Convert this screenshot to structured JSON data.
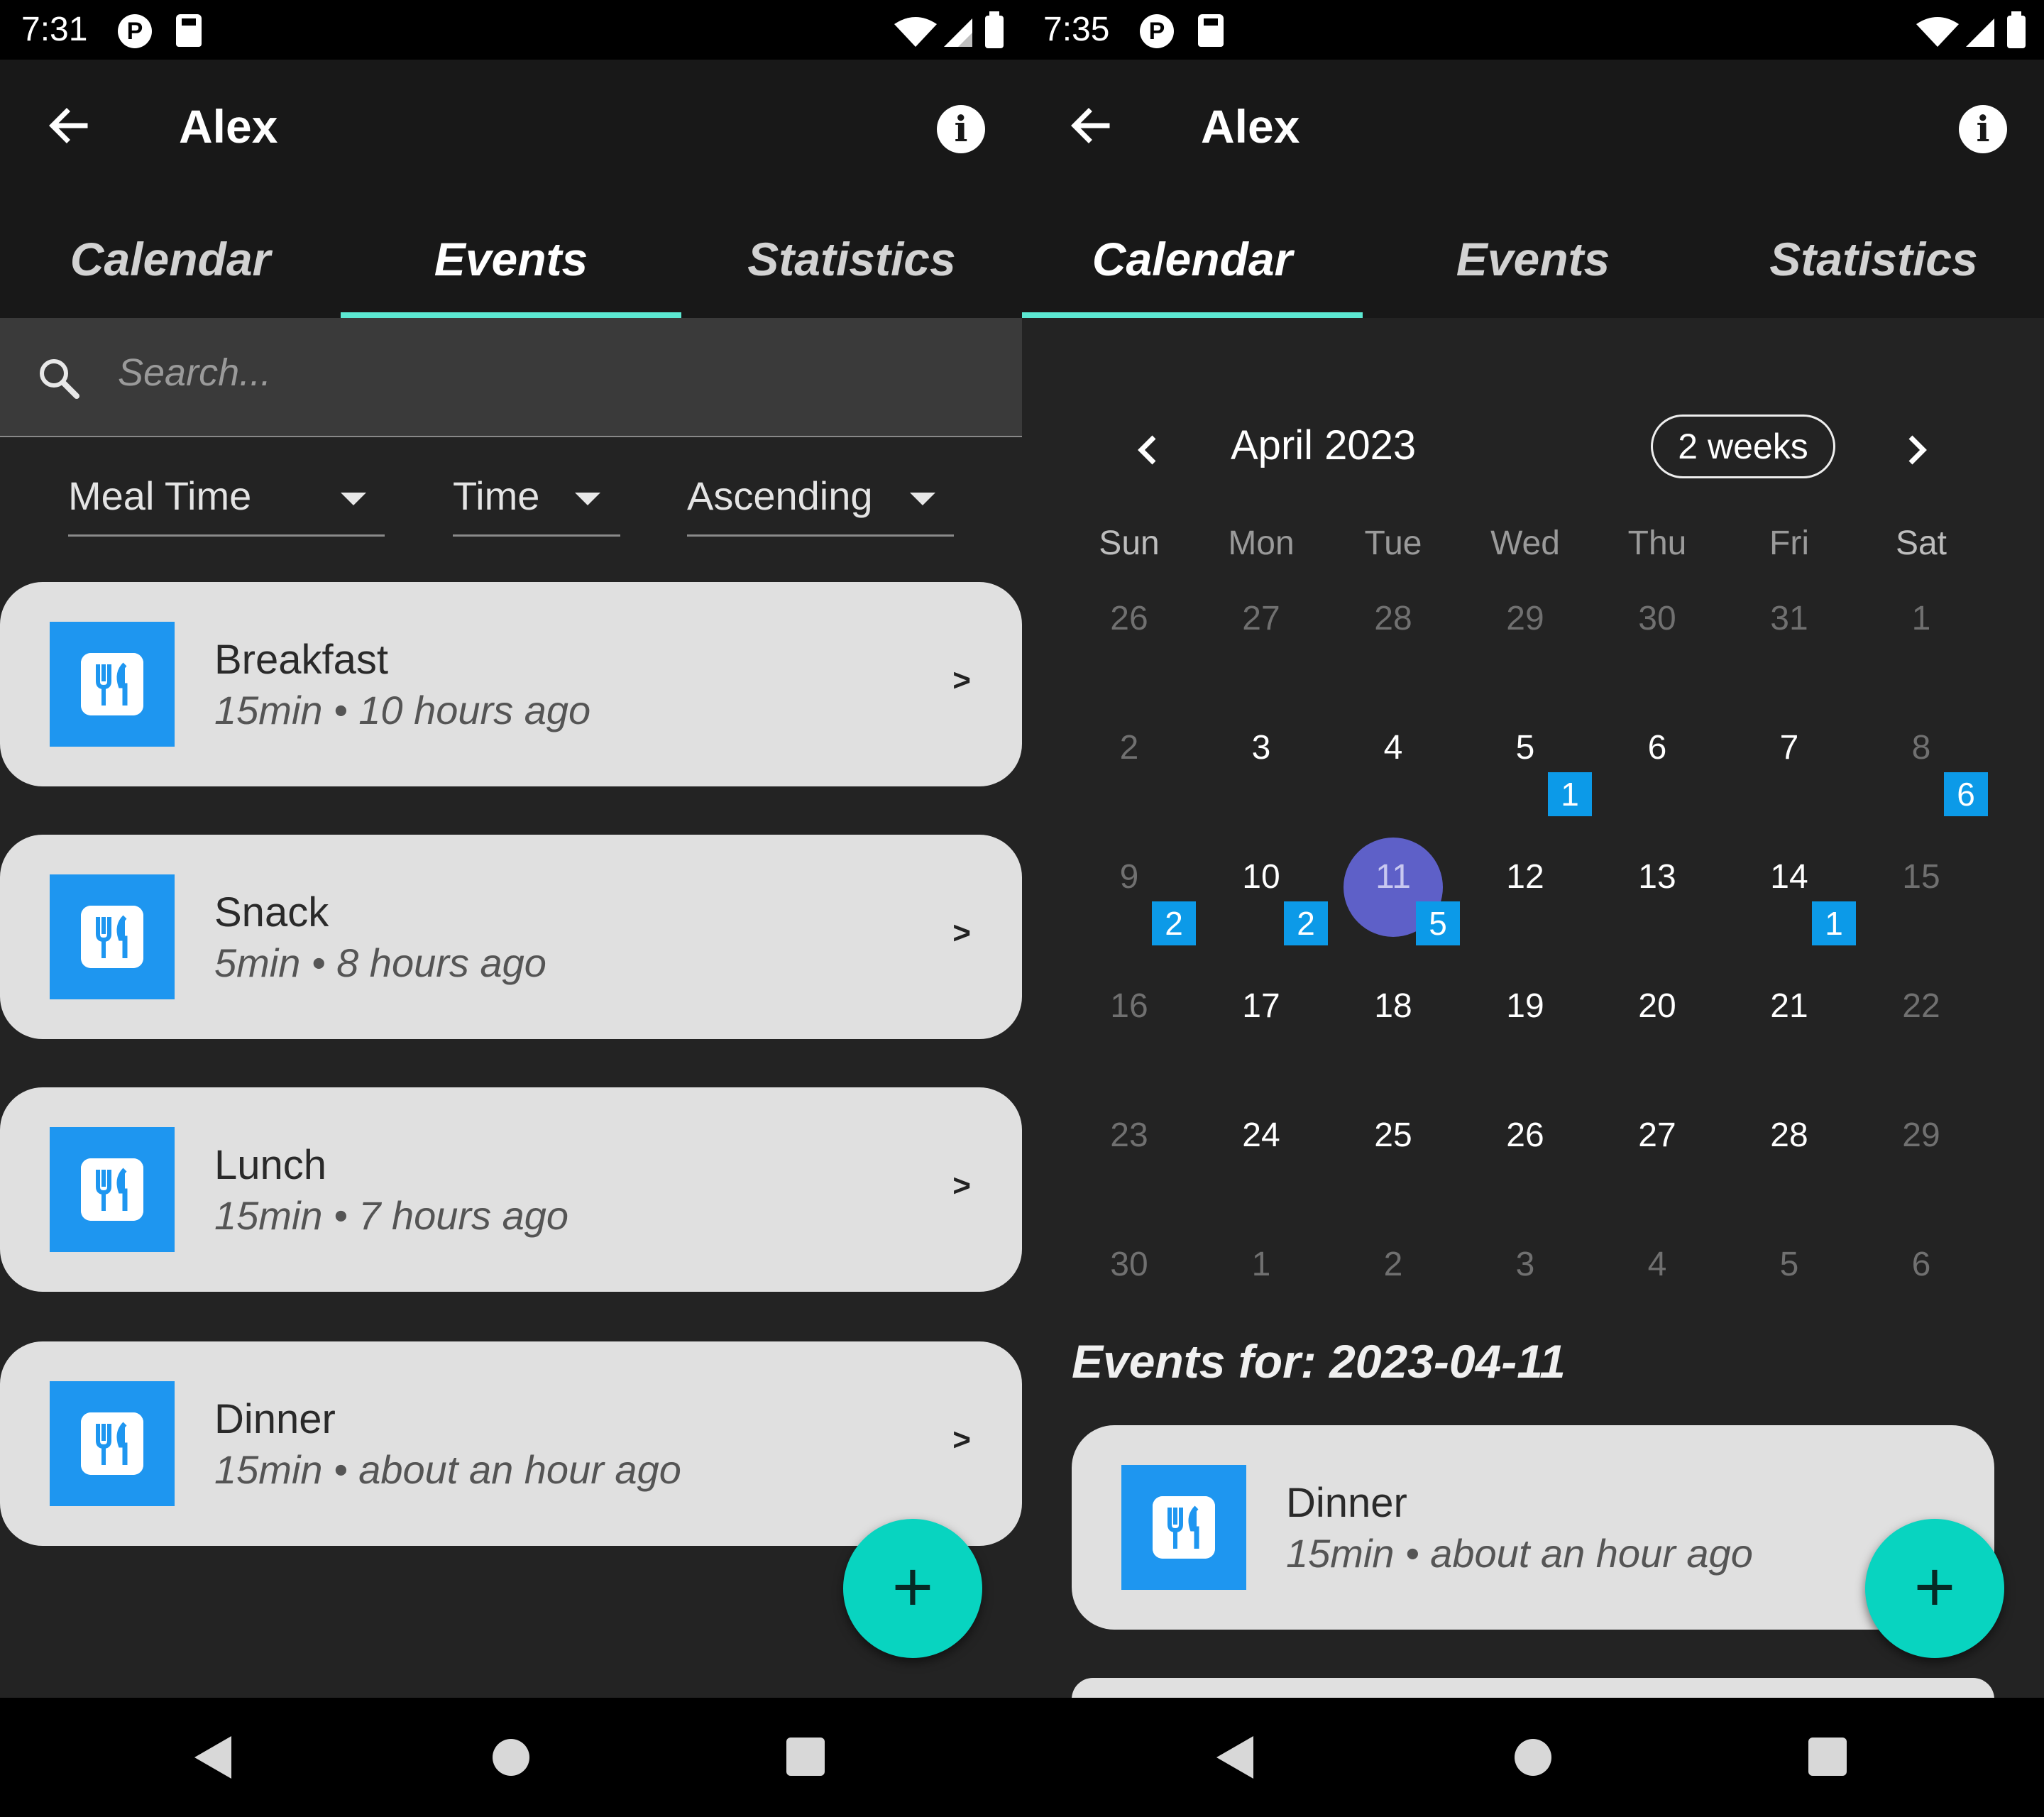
{
  "left": {
    "status": {
      "time": "7:31"
    },
    "appbar": {
      "title": "Alex"
    },
    "tabs": [
      {
        "label": "Calendar"
      },
      {
        "label": "Events"
      },
      {
        "label": "Statistics"
      }
    ],
    "active_tab": "Events",
    "search": {
      "placeholder": "Search..."
    },
    "filters": [
      {
        "value": "Meal Time"
      },
      {
        "value": "Time"
      },
      {
        "value": "Ascending"
      }
    ],
    "events": [
      {
        "name": "Breakfast",
        "meta": "15min • 10 hours ago",
        "chevron": ">"
      },
      {
        "name": "Snack",
        "meta": "5min • 8 hours ago",
        "chevron": ">"
      },
      {
        "name": "Lunch",
        "meta": "15min • 7 hours ago",
        "chevron": ">"
      },
      {
        "name": "Dinner",
        "meta": "15min • about an hour ago",
        "chevron": ">"
      }
    ],
    "fab": {
      "label": "+"
    }
  },
  "right": {
    "status": {
      "time": "7:35"
    },
    "appbar": {
      "title": "Alex"
    },
    "tabs": [
      {
        "label": "Calendar"
      },
      {
        "label": "Events"
      },
      {
        "label": "Statistics"
      }
    ],
    "active_tab": "Calendar",
    "calendar": {
      "month": "April 2023",
      "format_button": "2 weeks",
      "weekdays": [
        "Sun",
        "Mon",
        "Tue",
        "Wed",
        "Thu",
        "Fri",
        "Sat"
      ],
      "weeks": [
        [
          "26",
          "27",
          "28",
          "29",
          "30",
          "31",
          "1"
        ],
        [
          "2",
          "3",
          "4",
          "5",
          "6",
          "7",
          "8"
        ],
        [
          "9",
          "10",
          "11",
          "12",
          "13",
          "14",
          "15"
        ],
        [
          "16",
          "17",
          "18",
          "19",
          "20",
          "21",
          "22"
        ],
        [
          "23",
          "24",
          "25",
          "26",
          "27",
          "28",
          "29"
        ],
        [
          "30",
          "1",
          "2",
          "3",
          "4",
          "5",
          "6"
        ]
      ],
      "selected_day": "11",
      "event_counts": [
        {
          "day": "5",
          "count": "1"
        },
        {
          "day": "8",
          "count": "6"
        },
        {
          "day": "9",
          "count": "2"
        },
        {
          "day": "10",
          "count": "2"
        },
        {
          "day": "11",
          "count": "5"
        },
        {
          "day": "14",
          "count": "1"
        }
      ]
    },
    "events_for": "Events for: 2023-04-11",
    "events": [
      {
        "name": "Dinner",
        "meta": "15min • about an hour ago"
      }
    ],
    "fab": {
      "label": "+"
    }
  },
  "colors": {
    "accent_tab": "#5ce8d2",
    "fab": "#08d4c0",
    "event_icon": "#1e96f0",
    "badge": "#0c9ae8",
    "selected_day": "#5e60c8"
  },
  "icons": {
    "back": "arrow-left-icon",
    "info": "info-icon",
    "search": "search-icon",
    "meal": "fork-knife-icon",
    "nav_back": "triangle-back-icon",
    "nav_home": "circle-home-icon",
    "nav_recent": "square-recent-icon"
  }
}
